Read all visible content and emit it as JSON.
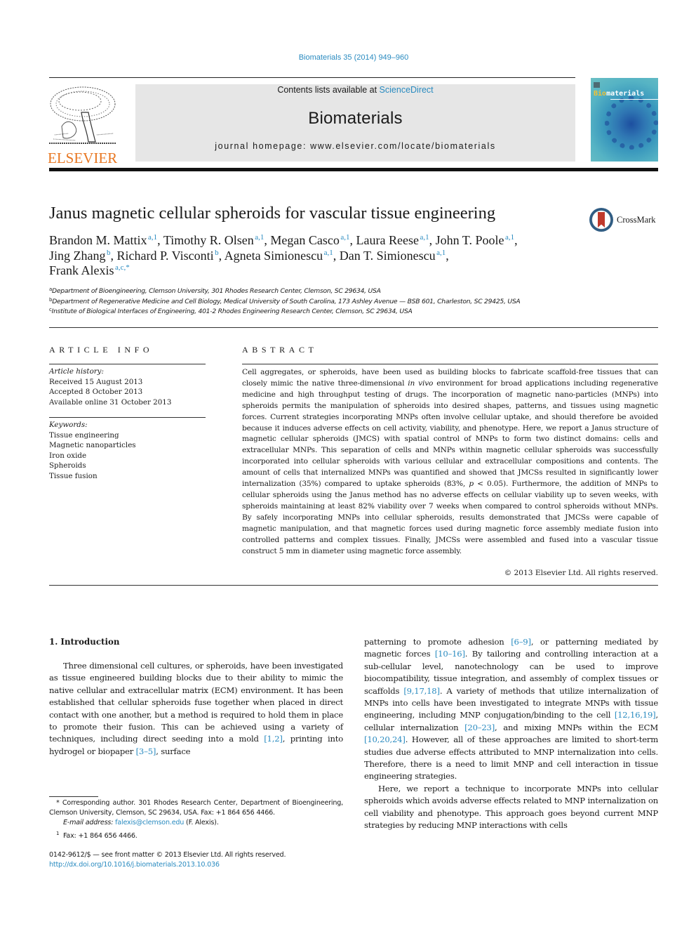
{
  "header": {
    "citation": "Biomaterials 35 (2014) 949–960",
    "contents_prefix": "Contents lists available at ",
    "contents_link": "ScienceDirect",
    "journal_title": "Biomaterials",
    "homepage": "journal homepage: www.elsevier.com/locate/biomaterials",
    "publisher_logo_text": "ELSEVIER",
    "cover": {
      "title_highlight": "Bio",
      "title_rest": "materials"
    }
  },
  "article": {
    "title": "Janus magnetic cellular spheroids for vascular tissue engineering",
    "crossmark_label": "CrossMark",
    "authors": [
      {
        "name": "Brandon M. Mattix",
        "sup": "a,1",
        "sep": ", "
      },
      {
        "name": "Timothy R. Olsen",
        "sup": "a,1",
        "sep": ", "
      },
      {
        "name": "Megan Casco",
        "sup": "a,1",
        "sep": ", "
      },
      {
        "name": "Laura Reese",
        "sup": "a,1",
        "sep": ", "
      },
      {
        "name": "John T. Poole",
        "sup": "a,1",
        "sep": ","
      },
      {
        "name": "Jing Zhang",
        "sup": "b",
        "sep": ", "
      },
      {
        "name": "Richard P. Visconti",
        "sup": "b",
        "sep": ", "
      },
      {
        "name": "Agneta Simionescu",
        "sup": "a,1",
        "sep": ", "
      },
      {
        "name": "Dan T. Simionescu",
        "sup": "a,1",
        "sep": ","
      },
      {
        "name": "Frank Alexis",
        "sup": "a,c,*",
        "sep": ""
      }
    ],
    "affiliations": [
      {
        "key": "a",
        "text": "Department of Bioengineering, Clemson University, 301 Rhodes Research Center, Clemson, SC 29634, USA"
      },
      {
        "key": "b",
        "text": "Department of Regenerative Medicine and Cell Biology, Medical University of South Carolina, 173 Ashley Avenue — BSB 601, Charleston, SC 29425, USA"
      },
      {
        "key": "c",
        "text": "Institute of Biological Interfaces of Engineering, 401-2 Rhodes Engineering Research Center, Clemson, SC 29634, USA"
      }
    ]
  },
  "article_info": {
    "heading": "ARTICLE INFO",
    "history_label": "Article history:",
    "history": [
      "Received 15 August 2013",
      "Accepted 8 October 2013",
      "Available online 31 October 2013"
    ],
    "keywords_label": "Keywords:",
    "keywords": [
      "Tissue engineering",
      "Magnetic nanoparticles",
      "Iron oxide",
      "Spheroids",
      "Tissue fusion"
    ]
  },
  "abstract": {
    "heading": "ABSTRACT",
    "part1": "Cell aggregates, or spheroids, have been used as building blocks to fabricate scaffold-free tissues that can closely mimic the native three-dimensional ",
    "part1_italic": "in vivo",
    "part2": " environment for broad applications including regenerative medicine and high throughput testing of drugs. The incorporation of magnetic nano-particles (MNPs) into spheroids permits the manipulation of spheroids into desired shapes, patterns, and tissues using magnetic forces. Current strategies incorporating MNPs often involve cellular uptake, and should therefore be avoided because it induces adverse effects on cell activity, viability, and phenotype. Here, we report a Janus structure of magnetic cellular spheroids (JMCS) with spatial control of MNPs to form two distinct domains: cells and extracellular MNPs. This separation of cells and MNPs within magnetic cellular spheroids was successfully incorporated into cellular spheroids with various cellular and extracellular compositions and contents. The amount of cells that internalized MNPs was quantified and showed that JMCSs resulted in significantly lower internalization (35%) compared to uptake spheroids (83%, ",
    "part2_italic": "p",
    "part3": " < 0.05). Furthermore, the addition of MNPs to cellular spheroids using the Janus method has no adverse effects on cellular viability up to seven weeks, with spheroids maintaining at least 82% viability over 7 weeks when compared to control spheroids without MNPs. By safely incorporating MNPs into cellular spheroids, results demonstrated that JMCSs were capable of magnetic manipulation, and that magnetic forces used during magnetic force assembly mediate fusion into controlled patterns and complex tissues. Finally, JMCSs were assembled and fused into a vascular tissue construct 5 mm in diameter using magnetic force assembly.",
    "copyright": "© 2013 Elsevier Ltd. All rights reserved."
  },
  "introduction": {
    "heading": "1.  Introduction",
    "left": [
      {
        "t": "Three dimensional cell cultures, or spheroids, have been investigated as tissue engineered building blocks due to their ability to mimic the native cellular and extracellular matrix (ECM) environment. It has been established that cellular spheroids fuse together when placed in direct contact with one another, but a method is required to hold them in place to promote their fusion. This can be achieved using a variety of techniques, including direct seeding into a mold "
      },
      {
        "ref": "[1,2]"
      },
      {
        "t": ", printing into hydrogel or biopaper "
      },
      {
        "ref": "[3–5]"
      },
      {
        "t": ", surface"
      }
    ],
    "right_p1": [
      {
        "t": "patterning to promote adhesion "
      },
      {
        "ref": "[6–9]"
      },
      {
        "t": ", or patterning mediated by magnetic forces "
      },
      {
        "ref": "[10–16]"
      },
      {
        "t": ". By tailoring and controlling interaction at a sub-cellular level, nanotechnology can be used to improve biocompatibility, tissue integration, and assembly of complex tissues or scaffolds "
      },
      {
        "ref": "[9,17,18]"
      },
      {
        "t": ". A variety of methods that utilize internalization of MNPs into cells have been investigated to integrate MNPs with tissue engineering, including MNP conjugation/binding to the cell "
      },
      {
        "ref": "[12,16,19]"
      },
      {
        "t": ", cellular internalization "
      },
      {
        "ref": "[20–23]"
      },
      {
        "t": ", and mixing MNPs within the ECM "
      },
      {
        "ref": "[10,20,24]"
      },
      {
        "t": ". However, all of these approaches are limited to short-term studies due adverse effects attributed to MNP internalization into cells. Therefore, there is a need to limit MNP and cell interaction in tissue engineering strategies."
      }
    ],
    "right_p2": "Here, we report a technique to incorporate MNPs into cellular spheroids which avoids adverse effects related to MNP internalization on cell viability and phenotype. This approach goes beyond current MNP strategies by reducing MNP interactions with cells"
  },
  "footnotes": {
    "corresponding": "* Corresponding author. 301 Rhodes Research Center, Department of Bioengineering, Clemson University, Clemson, SC 29634, USA. Fax: +1 864 656 4466.",
    "email_label": "E-mail address:",
    "email": "falexis@clemson.edu",
    "email_suffix": " (F. Alexis).",
    "fax_note_mark": "1",
    "fax_note": "Fax: +1 864 656 4466.",
    "issn_line": "0142-9612/$ — see front matter © 2013 Elsevier Ltd. All rights reserved.",
    "doi": "http://dx.doi.org/10.1016/j.biomaterials.2013.10.036"
  },
  "colors": {
    "link": "#2a8bc0",
    "elsevier_orange": "#e87722",
    "masthead_bg": "#e6e6e6"
  }
}
